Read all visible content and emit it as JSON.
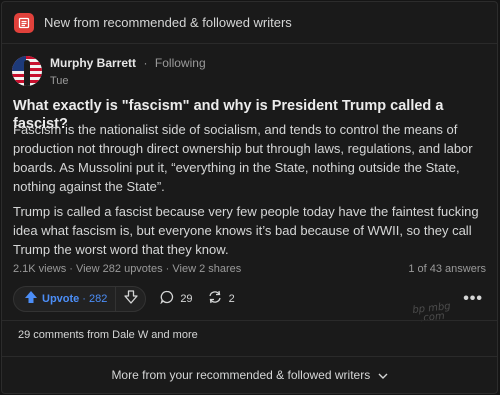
{
  "feed_header": {
    "title": "New from recommended & followed writers",
    "icon": "feed-icon"
  },
  "author": {
    "name": "Murphy Barrett",
    "separator": "·",
    "follow_status": "Following",
    "date": "Tue",
    "avatar": "american-flag-avatar"
  },
  "question": {
    "title": "What exactly is \"fascism\" and why is President Trump called a fascist?"
  },
  "answer": {
    "paragraphs": [
      "Fascism is the nationalist side of socialism, and tends to control the means of production not through direct ownership but through laws, regulations, and labor boards. As Mussolini put it, “everything in the State, nothing outside the State, nothing against the State”.",
      "Trump is called a fascist because very few people today have the faintest fucking idea what fascism is, but everyone knows it’s bad because of WWII, so they call Trump the worst word that they know."
    ]
  },
  "stats": {
    "text": "2.1K views · View 282 upvotes · View 2 shares",
    "answer_position": "1 of 43 answers"
  },
  "actions": {
    "upvote_label": "Upvote",
    "upvote_separator": "·",
    "upvote_count": "282",
    "comment_count": "29",
    "share_count": "2",
    "more_label": "•••"
  },
  "watermark": {
    "text": "bp mbg .com"
  },
  "comments": {
    "label": "29 comments from Dale W and more"
  },
  "footer": {
    "label": "More from your recommended & followed writers"
  },
  "colors": {
    "accent": "#4c8ef7",
    "feed_icon": "#e0413b",
    "background": "#1a1a1a",
    "text": "#d5d6d6"
  }
}
